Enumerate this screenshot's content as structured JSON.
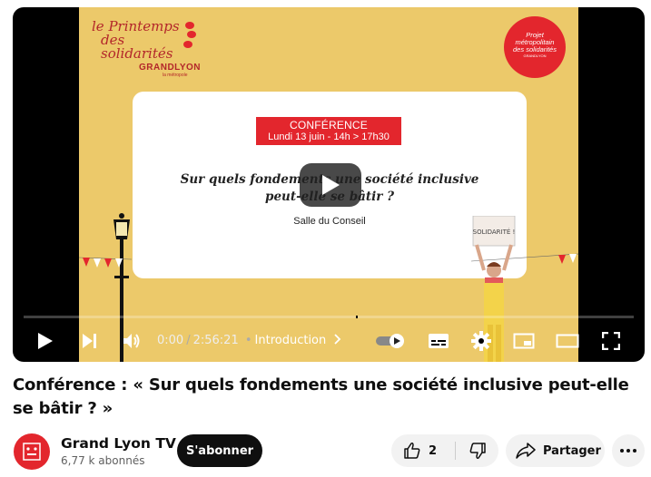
{
  "video": {
    "logo_left": {
      "line1": "le Printemps",
      "line2": "des solidarités",
      "line3": "GRANDLYON",
      "line4": "la métropole"
    },
    "logo_right": {
      "line1": "Projet",
      "line2": "métropolitain",
      "line3": "des solidarités",
      "line4": "GRANDLYON"
    },
    "card": {
      "banner_title": "CONFÉRENCE",
      "banner_date": "Lundi 13 juin - 14h > 17h30",
      "question_line1": "Sur quels fondements une société inclusive",
      "question_line2": "peut-elle se bâtir ?",
      "room": "Salle du Conseil"
    },
    "sign_text": "SOLIDARITÉ !",
    "progress_fraction": 0
  },
  "controls": {
    "current_time": "0:00",
    "separator": "/",
    "duration": "2:56:21",
    "bullet": "•",
    "chapter": "Introduction"
  },
  "meta": {
    "title": "Conférence : « Sur quels fondements une société inclusive peut-elle se bâtir ? »",
    "channel_name": "Grand Lyon TV",
    "subscribers": "6,77 k abonnés",
    "subscribe_label": "S'abonner",
    "like_count": "2",
    "share_label": "Partager"
  },
  "colors": {
    "video_bg": "#ecc96a",
    "brand_red": "#e3262d",
    "chip_bg": "#f2f2f2"
  }
}
